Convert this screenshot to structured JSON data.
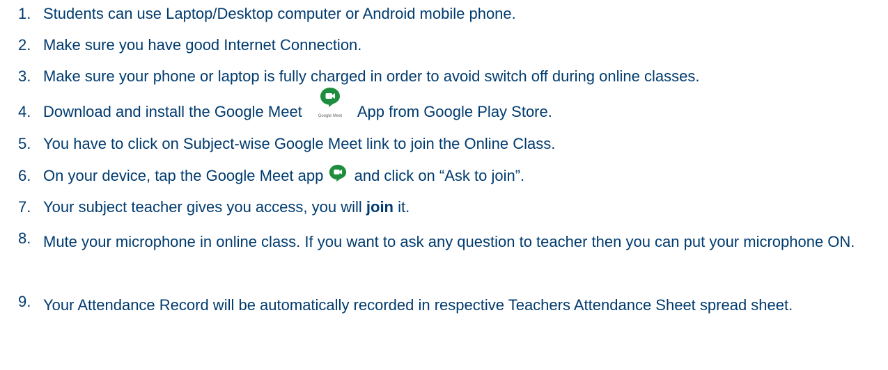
{
  "items": [
    {
      "num": "1.",
      "text": "Students can use Laptop/Desktop computer or Android mobile phone."
    },
    {
      "num": "2.",
      "text": "Make sure you have good Internet Connection."
    },
    {
      "num": "3.",
      "text": "Make sure your phone or laptop is fully charged in order to avoid switch off during online classes."
    },
    {
      "num": "4.",
      "text_before": "Download and install the Google Meet",
      "text_after": "App from Google Play Store.",
      "logo_caption": "Google Meet"
    },
    {
      "num": "5.",
      "text": "You have to click on Subject-wise Google Meet link to join the Online Class."
    },
    {
      "num": "6.",
      "text_before": "On your device, tap the Google Meet app",
      "text_after": "and click on “Ask to join”."
    },
    {
      "num": "7.",
      "text_before": "Your subject teacher gives you access, you will",
      "bold": "join",
      "text_after": "it."
    },
    {
      "num": "8.",
      "text": "Mute your microphone in online class. If you want to ask any question to teacher then you can put your microphone ON."
    },
    {
      "num": "9.",
      "text": "Your Attendance Record will be automatically recorded in respective Teachers Attendance Sheet spread sheet."
    }
  ],
  "colors": {
    "text": "#003b6f",
    "meet_green": "#00832d",
    "meet_teal": "#1e8e3e"
  },
  "icons": [
    "google-meet-logo-icon",
    "google-meet-app-icon"
  ]
}
